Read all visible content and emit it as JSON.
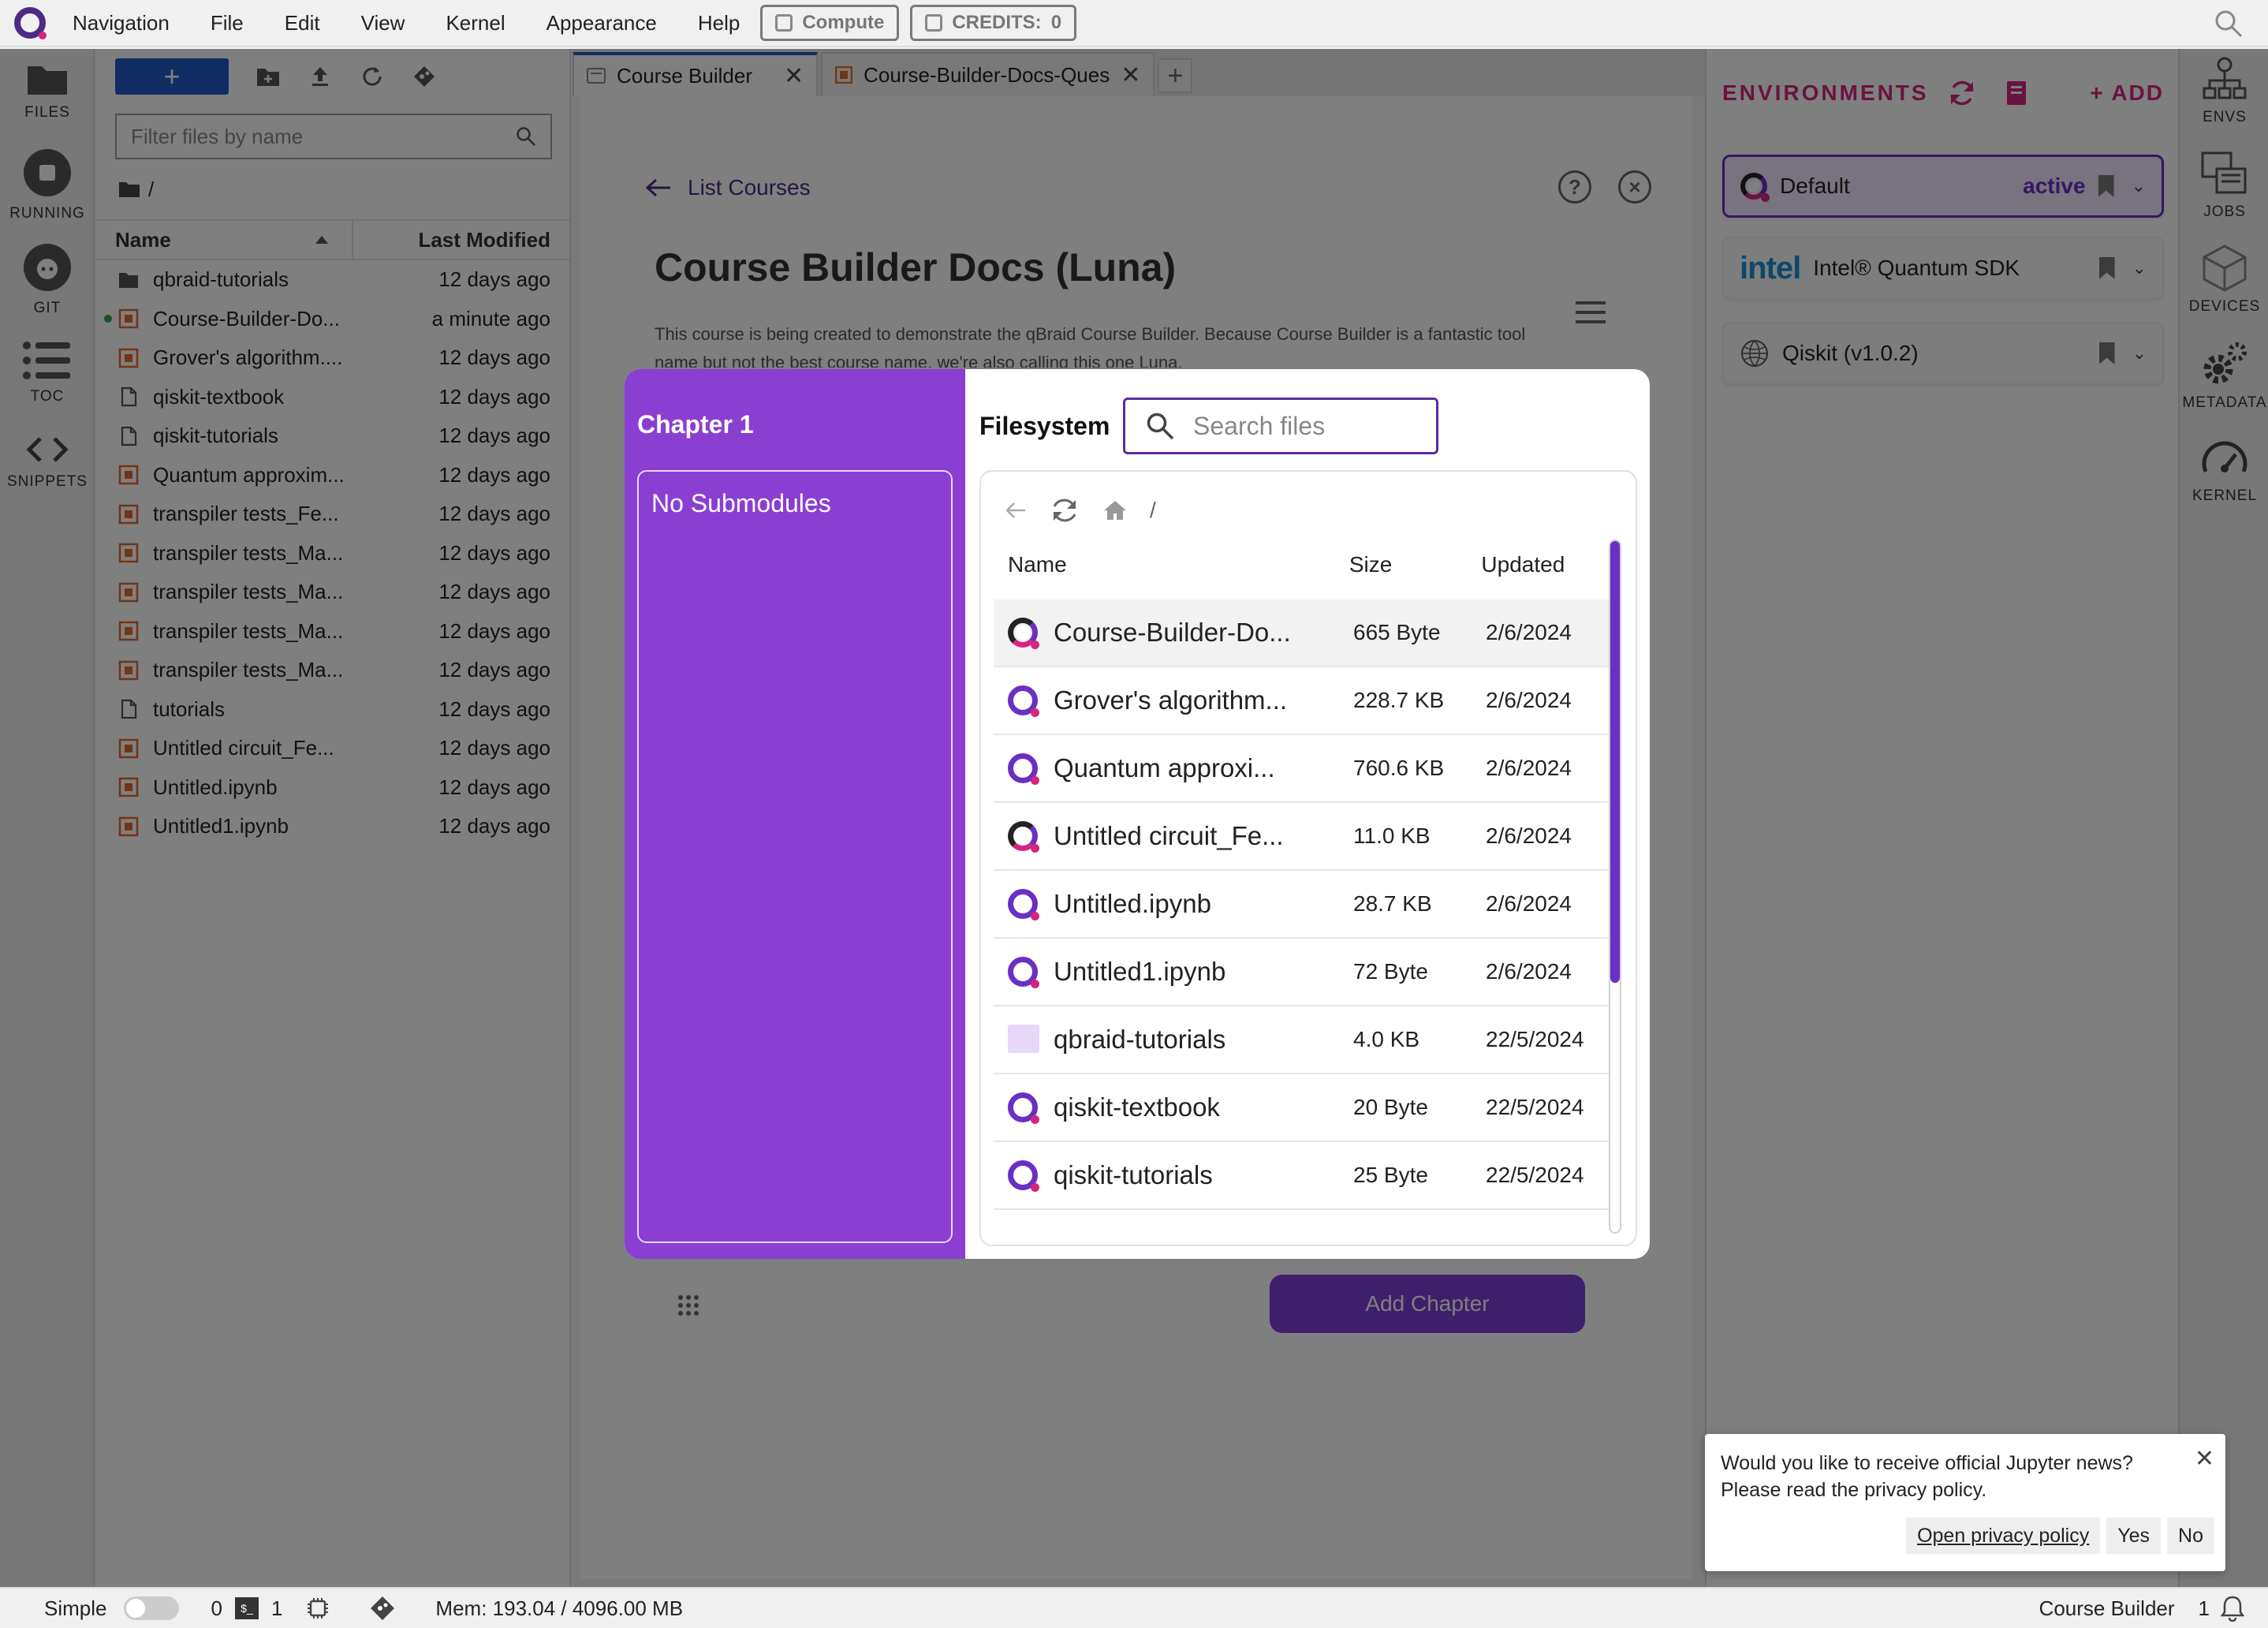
{
  "menubar": {
    "items": [
      "Navigation",
      "File",
      "Edit",
      "View",
      "Kernel",
      "Appearance",
      "Help"
    ],
    "compute_label": "Compute",
    "credits_label": "CREDITS:",
    "credits_value": "0"
  },
  "leftstrip": {
    "files": "FILES",
    "running": "RUNNING",
    "git": "GIT",
    "toc": "TOC",
    "snippets": "SNIPPETS"
  },
  "filebrowser": {
    "new_label": "+",
    "filter_placeholder": "Filter files by name",
    "path": "/",
    "col_name": "Name",
    "col_modified": "Last Modified",
    "files": [
      {
        "name": "qbraid-tutorials",
        "modified": "12 days ago",
        "type": "folder",
        "running": false
      },
      {
        "name": "Course-Builder-Do...",
        "modified": "a minute ago",
        "type": "notebook",
        "running": true
      },
      {
        "name": "Grover's algorithm....",
        "modified": "12 days ago",
        "type": "notebook",
        "running": false
      },
      {
        "name": "qiskit-textbook",
        "modified": "12 days ago",
        "type": "file",
        "running": false
      },
      {
        "name": "qiskit-tutorials",
        "modified": "12 days ago",
        "type": "file",
        "running": false
      },
      {
        "name": "Quantum approxim...",
        "modified": "12 days ago",
        "type": "notebook",
        "running": false
      },
      {
        "name": "transpiler tests_Fe...",
        "modified": "12 days ago",
        "type": "notebook",
        "running": false
      },
      {
        "name": "transpiler tests_Ma...",
        "modified": "12 days ago",
        "type": "notebook",
        "running": false
      },
      {
        "name": "transpiler tests_Ma...",
        "modified": "12 days ago",
        "type": "notebook",
        "running": false
      },
      {
        "name": "transpiler tests_Ma...",
        "modified": "12 days ago",
        "type": "notebook",
        "running": false
      },
      {
        "name": "transpiler tests_Ma...",
        "modified": "12 days ago",
        "type": "notebook",
        "running": false
      },
      {
        "name": "tutorials",
        "modified": "12 days ago",
        "type": "file",
        "running": false
      },
      {
        "name": "Untitled circuit_Fe...",
        "modified": "12 days ago",
        "type": "notebook",
        "running": false
      },
      {
        "name": "Untitled.ipynb",
        "modified": "12 days ago",
        "type": "notebook",
        "running": false
      },
      {
        "name": "Untitled1.ipynb",
        "modified": "12 days ago",
        "type": "notebook",
        "running": false
      }
    ]
  },
  "tabs": [
    {
      "label": "Course Builder",
      "active": true
    },
    {
      "label": "Course-Builder-Docs-Ques",
      "active": false
    }
  ],
  "tab_add": "+",
  "doc": {
    "back_label": "List Courses",
    "help_icon": "?",
    "close_icon": "×",
    "title": "Course Builder Docs (Luna)",
    "description": "This course is being created to demonstrate the qBraid Course Builder. Because Course Builder is a fantastic tool name but not the best course name, we're also calling this one Luna.",
    "add_chapter_label": "Add Chapter"
  },
  "modal": {
    "chapter_title": "Chapter 1",
    "submodules_empty": "No Submodules",
    "filesystem_label": "Filesystem",
    "search_placeholder": "Search files",
    "path": "/",
    "col_name": "Name",
    "col_size": "Size",
    "col_updated": "Updated",
    "files": [
      {
        "name": "Course-Builder-Do...",
        "size": "665 Byte",
        "updated": "2/6/2024",
        "type": "dark"
      },
      {
        "name": "Grover's algorithm...",
        "size": "228.7 KB",
        "updated": "2/6/2024",
        "type": "notebook"
      },
      {
        "name": "Quantum approxi...",
        "size": "760.6 KB",
        "updated": "2/6/2024",
        "type": "notebook"
      },
      {
        "name": "Untitled circuit_Fe...",
        "size": "11.0 KB",
        "updated": "2/6/2024",
        "type": "dark"
      },
      {
        "name": "Untitled.ipynb",
        "size": "28.7 KB",
        "updated": "2/6/2024",
        "type": "notebook"
      },
      {
        "name": "Untitled1.ipynb",
        "size": "72 Byte",
        "updated": "2/6/2024",
        "type": "notebook"
      },
      {
        "name": "qbraid-tutorials",
        "size": "4.0 KB",
        "updated": "22/5/2024",
        "type": "folder"
      },
      {
        "name": "qiskit-textbook",
        "size": "20 Byte",
        "updated": "22/5/2024",
        "type": "notebook"
      },
      {
        "name": "qiskit-tutorials",
        "size": "25 Byte",
        "updated": "22/5/2024",
        "type": "notebook"
      }
    ]
  },
  "environments": {
    "title": "ENVIRONMENTS",
    "add_label": "+ ADD",
    "items": [
      {
        "name": "Default",
        "status": "active"
      },
      {
        "name": "Intel® Quantum SDK",
        "status": ""
      },
      {
        "name": "Qiskit (v1.0.2)",
        "status": ""
      }
    ],
    "intel_logo_text": "intel"
  },
  "rightstrip": {
    "envs": "ENVS",
    "jobs": "JOBS",
    "devices": "DEVICES",
    "metadata": "METADATA",
    "kernel": "KERNEL"
  },
  "statusbar": {
    "mode_label": "Simple",
    "kernels_count": "0",
    "terminals_count": "1",
    "memory": "Mem: 193.04 / 4096.00 MB",
    "active_tab": "Course Builder",
    "notifications_count": "1"
  },
  "notification": {
    "message": "Would you like to receive official Jupyter news? Please read the privacy policy.",
    "privacy_label": "Open privacy policy",
    "yes_label": "Yes",
    "no_label": "No"
  },
  "colors": {
    "brand_purple": "#6a2fc4",
    "modal_panel": "#8a3ed2",
    "brand_pink": "#d3267f",
    "jupyter_blue": "#1e5bc6"
  }
}
